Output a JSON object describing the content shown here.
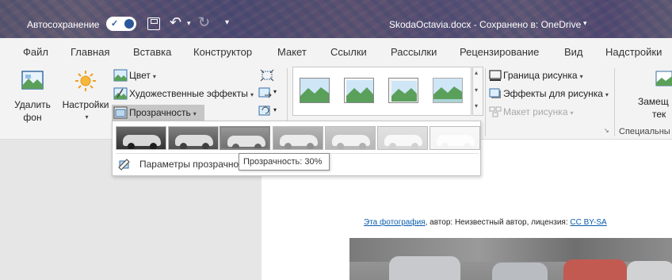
{
  "titlebar": {
    "autosave_label": "Автосохранение",
    "autosave_state": "on",
    "document_title": "SkodaOctavia.docx  -  Сохранено в: OneDrive",
    "icons": [
      "save-icon",
      "undo-icon",
      "redo-icon",
      "customize-quick-access-icon"
    ]
  },
  "tabs": [
    "Файл",
    "Главная",
    "Вставка",
    "Конструктор",
    "Макет",
    "Ссылки",
    "Рассылки",
    "Рецензирование",
    "Вид",
    "Надстройки"
  ],
  "ribbon": {
    "remove_bg_line1": "Удалить",
    "remove_bg_line2": "фон",
    "corrections": "Настройки",
    "color": "Цвет",
    "artistic_effects": "Художественные эффекты",
    "transparency": "Прозрачность",
    "picture_border": "Граница рисунка",
    "picture_effects": "Эффекты для рисунка",
    "picture_layout": "Макет рисунка",
    "alt_text_line1": "Замещ",
    "alt_text_line2": "тек",
    "group_special": "Специальны"
  },
  "transparency_menu": {
    "presets": [
      0,
      15,
      30,
      50,
      65,
      80,
      95
    ],
    "options_label": "Параметры прозрачности рисунка...",
    "tooltip": "Прозрачность: 30%"
  },
  "document": {
    "caption_link": "Эта фотография",
    "caption_text": ", автор: Неизвестный автор, лицензия: ",
    "caption_license": "CC BY-SA"
  },
  "colors": {
    "accent": "#2b579a",
    "link": "#0b5cad"
  }
}
